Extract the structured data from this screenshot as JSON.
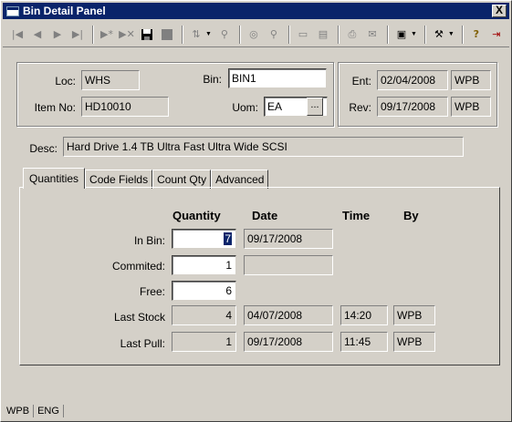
{
  "window": {
    "title": "Bin Detail Panel",
    "close_label": "X"
  },
  "toolbar": {
    "icons": [
      "first-record-icon",
      "prev-record-icon",
      "next-record-icon",
      "last-record-icon",
      "insert-record-icon",
      "delete-record-icon",
      "save-icon",
      "cancel-icon",
      "filter-icon",
      "find-icon",
      "search-web-icon",
      "zoom-icon",
      "form-view-icon",
      "document-icon",
      "print-icon",
      "email-icon",
      "report-icon",
      "tools-icon",
      "help-icon",
      "exit-icon"
    ]
  },
  "header": {
    "loc_label": "Loc:",
    "loc_value": "WHS",
    "bin_label": "Bin:",
    "bin_value": "BIN1",
    "item_label": "Item No:",
    "item_value": "HD10010",
    "uom_label": "Uom:",
    "uom_value": "EA",
    "uom_button": "...",
    "ent_label": "Ent:",
    "ent_date": "02/04/2008",
    "ent_by": "WPB",
    "rev_label": "Rev:",
    "rev_date": "09/17/2008",
    "rev_by": "WPB",
    "desc_label": "Desc:",
    "desc_value": "Hard Drive 1.4 TB Ultra Fast Ultra Wide SCSI"
  },
  "tabs": [
    "Quantities",
    "Code Fields",
    "Count Qty",
    "Advanced"
  ],
  "quantities": {
    "col_quantity": "Quantity",
    "col_date": "Date",
    "col_time": "Time",
    "col_by": "By",
    "in_bin_label": "In Bin:",
    "in_bin_qty": "7",
    "in_bin_date": "09/17/2008",
    "committed_label": "Commited:",
    "committed_qty": "1",
    "committed_date": "",
    "free_label": "Free:",
    "free_qty": "6",
    "last_stock_label": "Last Stock",
    "last_stock_qty": "4",
    "last_stock_date": "04/07/2008",
    "last_stock_time": "14:20",
    "last_stock_by": "WPB",
    "last_pull_label": "Last Pull:",
    "last_pull_qty": "1",
    "last_pull_date": "09/17/2008",
    "last_pull_time": "11:45",
    "last_pull_by": "WPB"
  },
  "statusbar": {
    "user": "WPB",
    "lang": "ENG"
  }
}
